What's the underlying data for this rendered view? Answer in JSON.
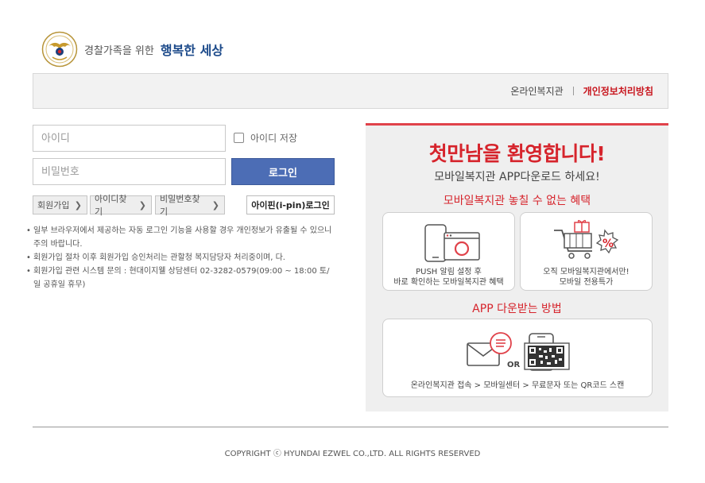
{
  "header": {
    "tagline": "경찰가족을 위한",
    "tagline_strong": "행복한 세상"
  },
  "topbar": {
    "link_welfare": "온라인복지관",
    "link_privacy": "개인정보처리방침"
  },
  "login": {
    "id_placeholder": "아이디",
    "pw_placeholder": "비밀번호",
    "remember_label": "아이디 저장",
    "remember_checked": false,
    "login_button": "로그인",
    "join_button": "회원가입",
    "find_id_button": "아이디찾기",
    "find_pw_button": "비밀번호찾기",
    "ipin_button": "아이핀(i-pin)로그인"
  },
  "notices": [
    "일부 브라우저에서 제공하는 자동 로그인 기능을 사용할 경우 개인정보가 유출될 수 있으니 주의 바랍니다.",
    "회원가입 절차 이후 회원가입 승인처리는 관할청 복지담당자 처리중이며, 다.",
    "회원가입 관련 시스템 문의 : 현대이지웰 상담센터 02-3282-0579(09:00 ~ 18:00 토/일 공휴일 휴무)"
  ],
  "promo": {
    "title": "첫만남을 환영합니다!",
    "subtitle": "모바일복지관 APP다운로드 하세요!",
    "benefit_heading": "모바일복지관 놓칠 수 없는 혜택",
    "push_text_1": "PUSH 알림 설정 후",
    "push_text_2": "바로 확인하는 모바일복지관 혜택",
    "exclusive_text_1": "오직 모바일복지관에서만!",
    "exclusive_text_2": "모바일 전용특가",
    "percent": "%",
    "method_heading": "APP 다운받는 방법",
    "or_label": "OR",
    "method_text": "온라인복지관 접속 > 모바일센터 > 무료문자 또는 QR코드 스캔"
  },
  "footer": {
    "copyright": "COPYRIGHT ⓒ HYUNDAI EZWEL CO.,LTD. ALL RIGHTS RESERVED"
  },
  "colors": {
    "accent_red": "#d6242c",
    "button_blue": "#4c6db5",
    "brand_navy": "#1c4a8a"
  }
}
